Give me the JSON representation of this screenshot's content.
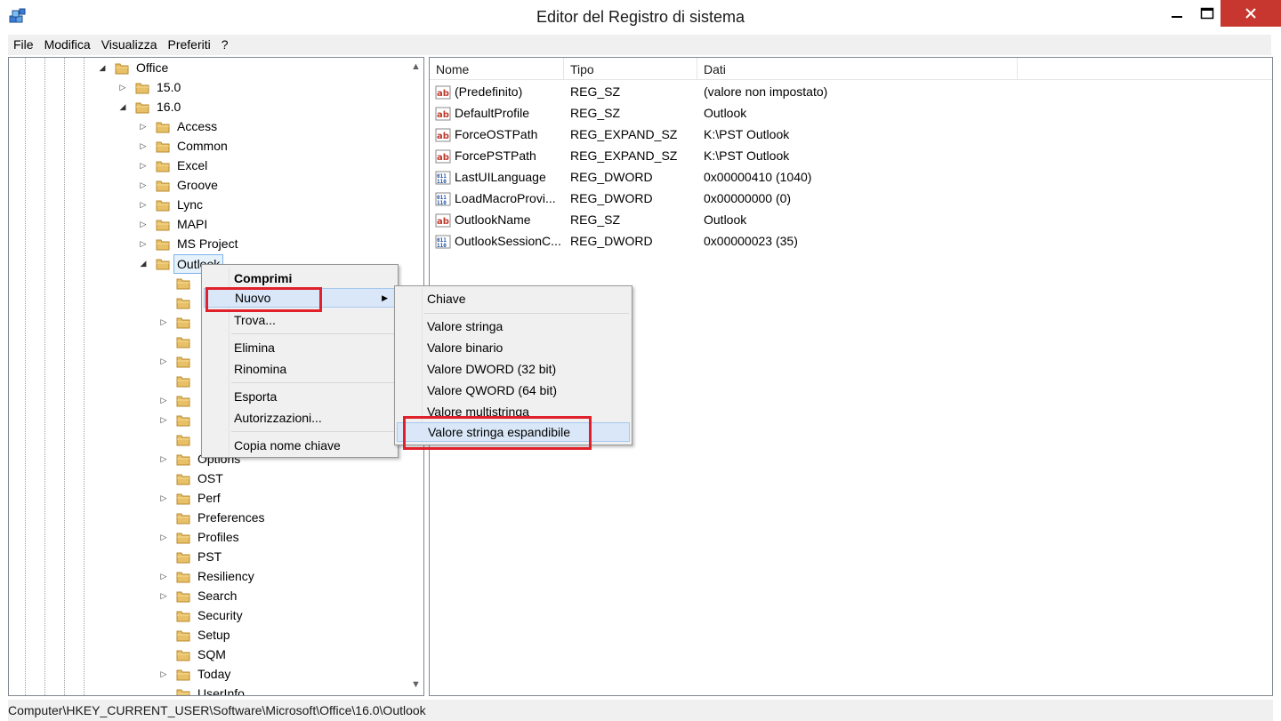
{
  "window": {
    "title": "Editor del Registro di sistema"
  },
  "menubar": {
    "items": [
      "File",
      "Modifica",
      "Visualizza",
      "Preferiti",
      "?"
    ]
  },
  "tree": {
    "items": [
      {
        "label": "Office",
        "expanded": true
      },
      {
        "label": "15.0",
        "expanded": false
      },
      {
        "label": "16.0",
        "expanded": true
      },
      {
        "label": "Access"
      },
      {
        "label": "Common"
      },
      {
        "label": "Excel"
      },
      {
        "label": "Groove"
      },
      {
        "label": "Lync"
      },
      {
        "label": "MAPI"
      },
      {
        "label": "MS Project"
      },
      {
        "label": "Outlook",
        "selected": true
      },
      {
        "label": ""
      },
      {
        "label": ""
      },
      {
        "label": ""
      },
      {
        "label": ""
      },
      {
        "label": ""
      },
      {
        "label": ""
      },
      {
        "label": ""
      },
      {
        "label": ""
      },
      {
        "label": ""
      },
      {
        "label": "Options"
      },
      {
        "label": "OST"
      },
      {
        "label": "Perf"
      },
      {
        "label": "Preferences"
      },
      {
        "label": "Profiles"
      },
      {
        "label": "PST"
      },
      {
        "label": "Resiliency"
      },
      {
        "label": "Search"
      },
      {
        "label": "Security"
      },
      {
        "label": "Setup"
      },
      {
        "label": "SQM"
      },
      {
        "label": "Today"
      },
      {
        "label": "UserInfo"
      }
    ]
  },
  "values": {
    "columns": [
      "Nome",
      "Tipo",
      "Dati"
    ],
    "rows": [
      {
        "name": "(Predefinito)",
        "type": "REG_SZ",
        "data": "(valore non impostato)",
        "icon": "string-value-icon"
      },
      {
        "name": "DefaultProfile",
        "type": "REG_SZ",
        "data": "Outlook",
        "icon": "string-value-icon"
      },
      {
        "name": "ForceOSTPath",
        "type": "REG_EXPAND_SZ",
        "data": "K:\\PST Outlook",
        "icon": "string-value-icon"
      },
      {
        "name": "ForcePSTPath",
        "type": "REG_EXPAND_SZ",
        "data": "K:\\PST Outlook",
        "icon": "string-value-icon"
      },
      {
        "name": "LastUILanguage",
        "type": "REG_DWORD",
        "data": "0x00000410 (1040)",
        "icon": "binary-value-icon"
      },
      {
        "name": "LoadMacroProvi...",
        "type": "REG_DWORD",
        "data": "0x00000000 (0)",
        "icon": "binary-value-icon"
      },
      {
        "name": "OutlookName",
        "type": "REG_SZ",
        "data": "Outlook",
        "icon": "string-value-icon"
      },
      {
        "name": "OutlookSessionC...",
        "type": "REG_DWORD",
        "data": "0x00000023 (35)",
        "icon": "binary-value-icon"
      }
    ]
  },
  "context_menu": {
    "items": [
      "Comprimi",
      "Nuovo",
      "Trova...",
      "Elimina",
      "Rinomina",
      "Esporta",
      "Autorizzazioni...",
      "Copia nome chiave"
    ]
  },
  "submenu": {
    "items": [
      "Chiave",
      "Valore stringa",
      "Valore binario",
      "Valore DWORD (32 bit)",
      "Valore QWORD (64 bit)",
      "Valore multistringa",
      "Valore stringa espandibile"
    ]
  },
  "statusbar": {
    "path": "Computer\\HKEY_CURRENT_USER\\Software\\Microsoft\\Office\\16.0\\Outlook"
  },
  "colors": {
    "close_button": "#c7372f",
    "highlight_box": "#e0202a",
    "menu_highlight": "#d9e7f8"
  }
}
